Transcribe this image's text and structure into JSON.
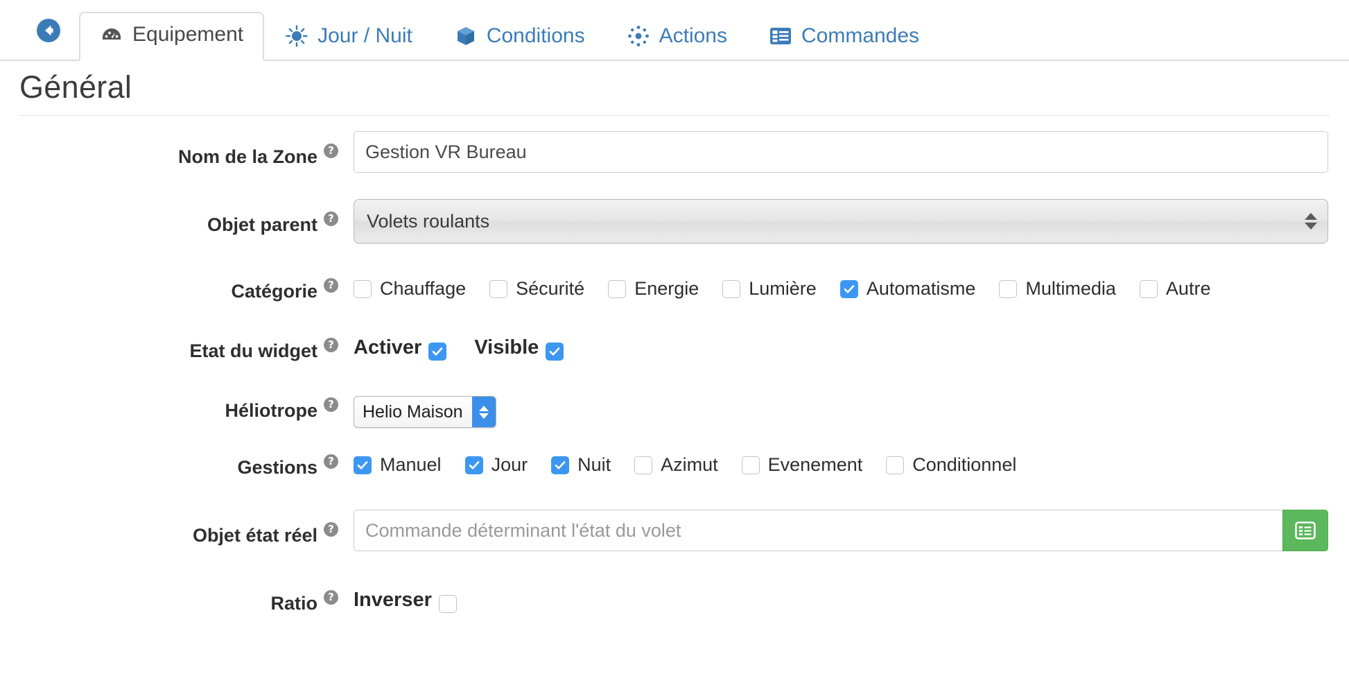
{
  "nav": {
    "back_icon": "arrow-circle-left-icon",
    "tabs": [
      {
        "label": "Equipement",
        "icon": "tachometer-icon",
        "active": true
      },
      {
        "label": "Jour / Nuit",
        "icon": "sun-icon",
        "active": false
      },
      {
        "label": "Conditions",
        "icon": "cube-icon",
        "active": false
      },
      {
        "label": "Actions",
        "icon": "asterisk-burst-icon",
        "active": false
      },
      {
        "label": "Commandes",
        "icon": "list-alt-icon",
        "active": false
      }
    ]
  },
  "page": {
    "title": "Général"
  },
  "form": {
    "help_glyph": "?",
    "zone_name": {
      "label": "Nom de la Zone",
      "value": "Gestion VR Bureau",
      "placeholder": "Nom de la Zone"
    },
    "parent_object": {
      "label": "Objet parent",
      "value": "Volets roulants"
    },
    "category": {
      "label": "Catégorie",
      "options": [
        {
          "label": "Chauffage",
          "checked": false
        },
        {
          "label": "Sécurité",
          "checked": false
        },
        {
          "label": "Energie",
          "checked": false
        },
        {
          "label": "Lumière",
          "checked": false
        },
        {
          "label": "Automatisme",
          "checked": true
        },
        {
          "label": "Multimedia",
          "checked": false
        },
        {
          "label": "Autre",
          "checked": false
        }
      ]
    },
    "widget_state": {
      "label": "Etat du widget",
      "options": [
        {
          "label": "Activer",
          "checked": true
        },
        {
          "label": "Visible",
          "checked": true
        }
      ]
    },
    "heliotrope": {
      "label": "Héliotrope",
      "value": "Helio Maison"
    },
    "gestions": {
      "label": "Gestions",
      "options": [
        {
          "label": "Manuel",
          "checked": true
        },
        {
          "label": "Jour",
          "checked": true
        },
        {
          "label": "Nuit",
          "checked": true
        },
        {
          "label": "Azimut",
          "checked": false
        },
        {
          "label": "Evenement",
          "checked": false
        },
        {
          "label": "Conditionnel",
          "checked": false
        }
      ]
    },
    "real_state_object": {
      "label": "Objet état réel",
      "value": "",
      "placeholder": "Commande déterminant l'état du volet",
      "addon_icon": "list-alt-icon"
    },
    "ratio": {
      "label": "Ratio",
      "invert_label": "Inverser",
      "invert_checked": false
    }
  },
  "colors": {
    "tab_link": "#3b7cb8",
    "checkbox_checked": "#3d97f2",
    "addon_green": "#5cb85c",
    "help_gray": "#8b8b8b"
  }
}
